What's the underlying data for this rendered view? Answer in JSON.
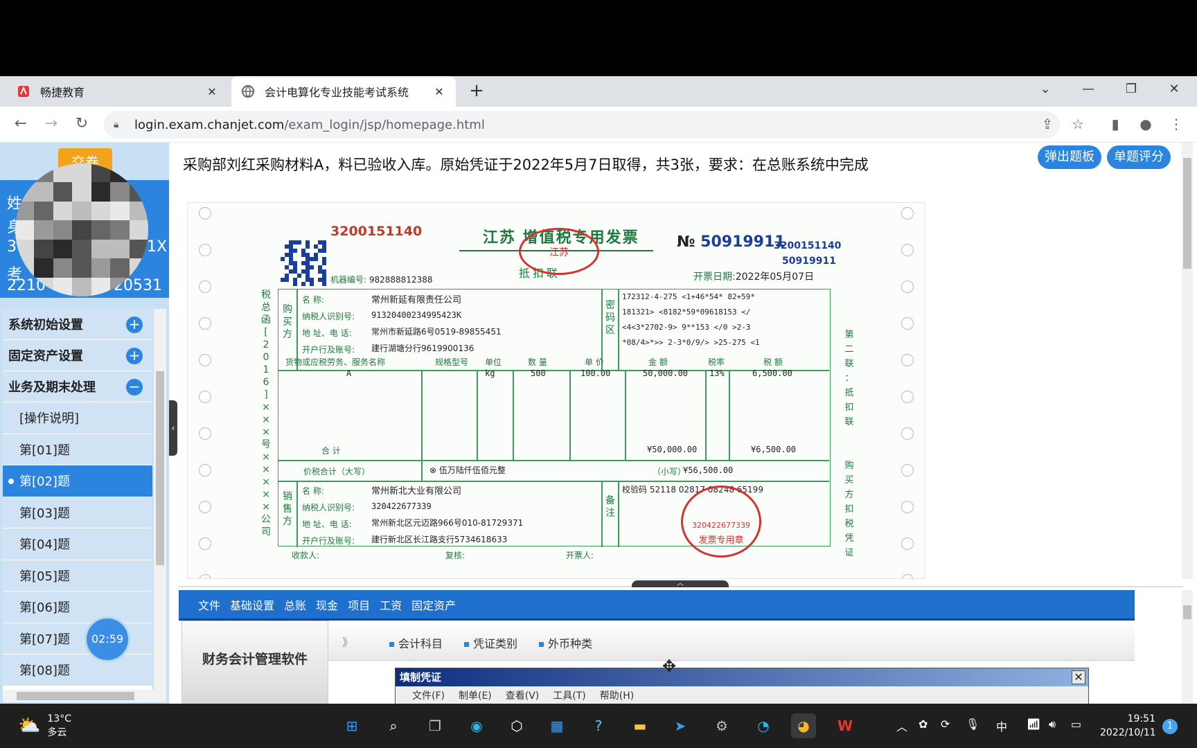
{
  "browser": {
    "tabs": [
      {
        "title": "畅捷教育",
        "active": false
      },
      {
        "title": "会计电算化专业技能考试系统",
        "active": true
      }
    ],
    "url_host": "login.exam.chanjet.com",
    "url_path": "/exam_login/jsp/homepage.html"
  },
  "sidebar": {
    "submit_label": "交卷",
    "user_lines": [
      "姓",
      "身",
      "3",
      "1X",
      "考",
      "2210",
      "20531"
    ],
    "groups": [
      {
        "label": "系统初始设置",
        "toggle": "+"
      },
      {
        "label": "固定资产设置",
        "toggle": "+"
      },
      {
        "label": "业务及期末处理",
        "toggle": "−"
      }
    ],
    "items": [
      "[操作说明]",
      "第[01]题",
      "第[02]题",
      "第[03]题",
      "第[04]题",
      "第[05]题",
      "第[06]题",
      "第[07]题",
      "第[08]题"
    ],
    "selected_index": 2,
    "timer": "02:59"
  },
  "question": {
    "text": "采购部刘红采购材料A，料已验收入库。原始凭证于2022年5月7日取得，共3张，要求：在总账系统中完成",
    "popup_button": "弹出题板",
    "score_button": "单题评分"
  },
  "invoice": {
    "code": "3200151140",
    "title": "江苏  增值税专用发票",
    "copy_label": "抵扣联",
    "no_prefix": "№",
    "number": "50919911",
    "code_right": "3200151140",
    "number_right": "50919911",
    "date_label": "开票日期:",
    "date": "2022年05月07日",
    "machine_label": "机器编号:",
    "machine_no": "982888812388",
    "left_side": "税总函[2016]×××号×××××公司",
    "right_side": "第二联：抵扣联 购买方扣税凭证",
    "buyer_label": "购买方",
    "buyer": {
      "name_label": "名     称:",
      "name": "常州新延有限责任公司",
      "tax_label": "纳税人识别号:",
      "tax_id": "91320400234995423K",
      "addr_label": "地 址、电 话:",
      "addr": "常州市新延路6号0519-89855451",
      "bank_label": "开户行及账号:",
      "bank": "建行湖塘分行9619900136"
    },
    "cipher_label": "密码区",
    "cipher": [
      "172312-4-275 <1+46*54* 82+59*",
      "181321> <8182*59*09618153 </",
      "<4<3*2702-9> 9**153 </0 >2-3",
      "*08/4>*>> 2-3*0/9/> >25-275 <1"
    ],
    "headers": [
      "货物或应税劳务、服务名称",
      "规格型号",
      "单位",
      "数 量",
      "单 价",
      "金 额",
      "税率",
      "税 额"
    ],
    "row": {
      "name": "A",
      "spec": "",
      "unit": "kg",
      "qty": "500",
      "price": "100.00",
      "amount": "50,000.00",
      "rate": "13%",
      "tax": "6,500.00"
    },
    "total_label": "合        计",
    "total_amount": "¥50,000.00",
    "total_tax": "¥6,500.00",
    "grand_label": "价税合计（大写）",
    "grand_words": "⊗ 伍万陆仟伍佰元整",
    "grand_small_label": "（小写）",
    "grand_small": "¥56,500.00",
    "seller_label": "销售方",
    "seller": {
      "name_label": "名     称:",
      "name": "常州新北大业有限公司",
      "tax_label": "纳税人识别号:",
      "tax_id": "320422677339",
      "addr_label": "地 址、电 话:",
      "addr": "常州新北区元迈路966号010-81729371",
      "bank_label": "开户行及账号:",
      "bank": "建行新北区长江路支行5734618633"
    },
    "remark_label": "备注",
    "remark": "校验码  52118  02817  08248  65199",
    "payee_label": "收款人:",
    "reviewer_label": "复核:",
    "drawer_label": "开票人:",
    "stamp_top_inner": "江苏",
    "stamp_seller_text": "发票专用章",
    "stamp_seller_no": "320422677339"
  },
  "app": {
    "menus": [
      "文件",
      "基础设置",
      "总账",
      "现金",
      "项目",
      "工资",
      "固定资产"
    ],
    "logo_text": "财务会计管理软件",
    "quick_links": [
      "会计科目",
      "凭证类别",
      "外币种类"
    ],
    "dialog_title": "填制凭证",
    "dialog_menus": [
      "文件(F)",
      "制单(E)",
      "查看(V)",
      "工具(T)",
      "帮助(H)"
    ]
  },
  "taskbar": {
    "temperature": "13°C",
    "weather": "多云",
    "ime": "中",
    "time": "19:51",
    "date": "2022/10/11",
    "notifications": "1"
  }
}
